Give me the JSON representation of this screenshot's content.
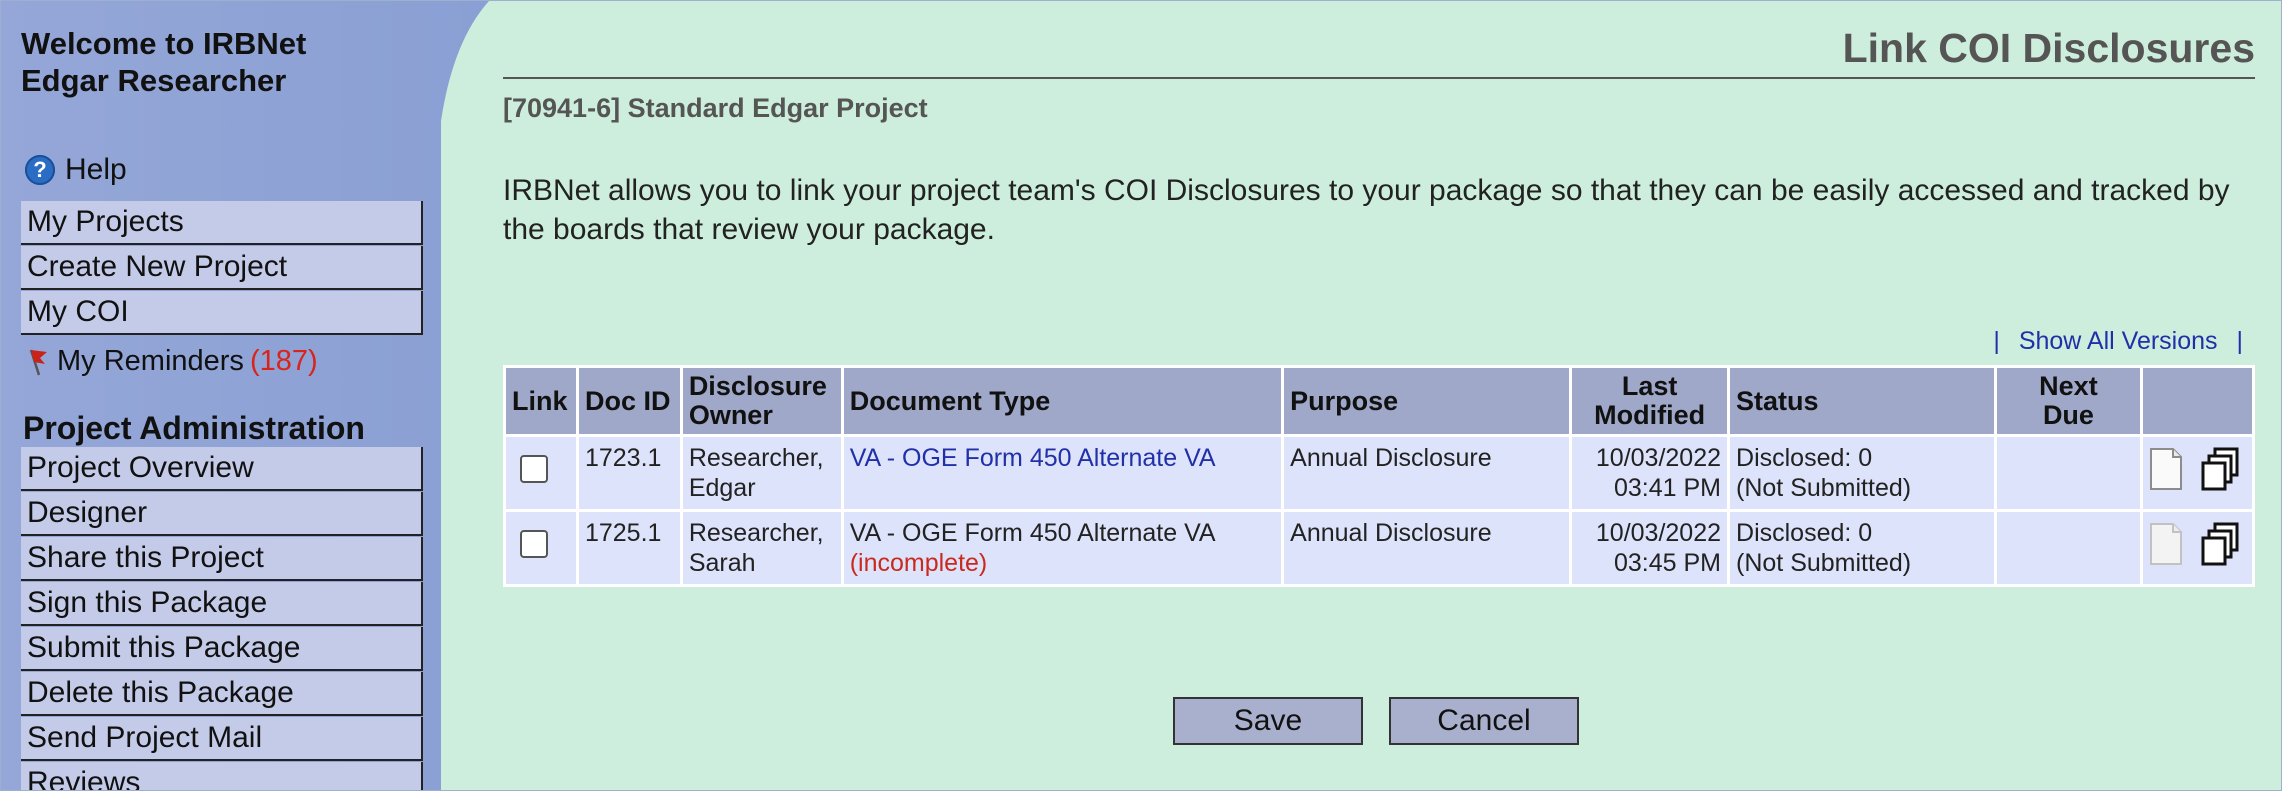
{
  "sidebar": {
    "welcome_line1": "Welcome to IRBNet",
    "welcome_line2": "Edgar Researcher",
    "help_label": "Help",
    "top_menu": [
      {
        "label": "My Projects"
      },
      {
        "label": "Create New Project"
      },
      {
        "label": "My COI"
      }
    ],
    "reminders_label": "My Reminders",
    "reminders_count": "(187)",
    "section_heading": "Project Administration",
    "admin_menu": [
      {
        "label": "Project Overview"
      },
      {
        "label": "Designer"
      },
      {
        "label": "Share this Project"
      },
      {
        "label": "Sign this Package"
      },
      {
        "label": "Submit this Package"
      },
      {
        "label": "Delete this Package"
      },
      {
        "label": "Send Project Mail"
      },
      {
        "label": "Reviews"
      }
    ]
  },
  "main": {
    "page_title": "Link COI Disclosures",
    "project_name": "[70941-6] Standard Edgar Project",
    "intro_text": "IRBNet allows you to link your project team's COI Disclosures to your package so that they can be easily accessed and tracked by the boards that review your package.",
    "versions_separator": "|",
    "show_all_versions": "Show All Versions"
  },
  "table": {
    "headers": {
      "link": "Link",
      "doc_id": "Doc ID",
      "owner_line1": "Disclosure",
      "owner_line2": "Owner",
      "document_type": "Document Type",
      "purpose": "Purpose",
      "modified_line1": "Last",
      "modified_line2": "Modified",
      "status": "Status",
      "next_due_line1": "Next",
      "next_due_line2": "Due"
    },
    "rows": [
      {
        "doc_id": "1723.1",
        "owner_line1": "Researcher,",
        "owner_line2": "Edgar",
        "document_type": "VA - OGE Form 450 Alternate VA",
        "document_note": "",
        "purpose": "Annual Disclosure",
        "modified_date": "10/03/2022",
        "modified_time": "03:41 PM",
        "status_line1": "Disclosed: 0",
        "status_line2": "(Not Submitted)",
        "next_due": ""
      },
      {
        "doc_id": "1725.1",
        "owner_line1": "Researcher,",
        "owner_line2": "Sarah",
        "document_type": "VA - OGE Form 450 Alternate VA",
        "document_note": "(incomplete)",
        "purpose": "Annual Disclosure",
        "modified_date": "10/03/2022",
        "modified_time": "03:45 PM",
        "status_line1": "Disclosed: 0",
        "status_line2": "(Not Submitted)",
        "next_due": ""
      }
    ]
  },
  "buttons": {
    "save": "Save",
    "cancel": "Cancel"
  },
  "colors": {
    "main_background": "#cdeedd",
    "sidebar_background": "#8fa3d6",
    "menu_item_background": "#c4cbe9",
    "table_header_background": "#9fa8c8",
    "table_row_background": "#dde3fa",
    "link_color": "#2130a8",
    "alert_color": "#c92a1e"
  },
  "icons": {
    "help": "help-circle-icon",
    "reminders": "red-flag-icon",
    "document": "document-icon",
    "copy": "copy-pages-icon"
  }
}
